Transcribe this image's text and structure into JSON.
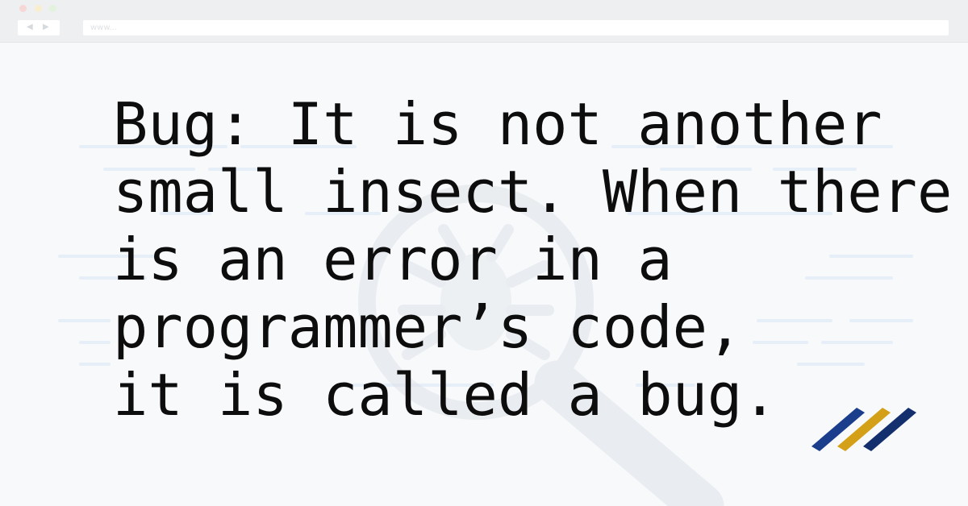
{
  "browser": {
    "back_icon": "chevron-left-icon",
    "forward_icon": "chevron-right-icon",
    "back_glyph": "◀",
    "forward_glyph": "▶",
    "url_text": "www..."
  },
  "quote": {
    "text": "Bug: It is not another\nsmall insect. When there\nis an error in a\nprogrammer’s code,\nit is called a bug."
  },
  "decor": {
    "background_icon": "magnifier-bug-icon",
    "logo_icon": "three-stripe-logo-icon",
    "logo_colors": [
      "#1a3d8c",
      "#d4a017",
      "#142f6e"
    ]
  }
}
